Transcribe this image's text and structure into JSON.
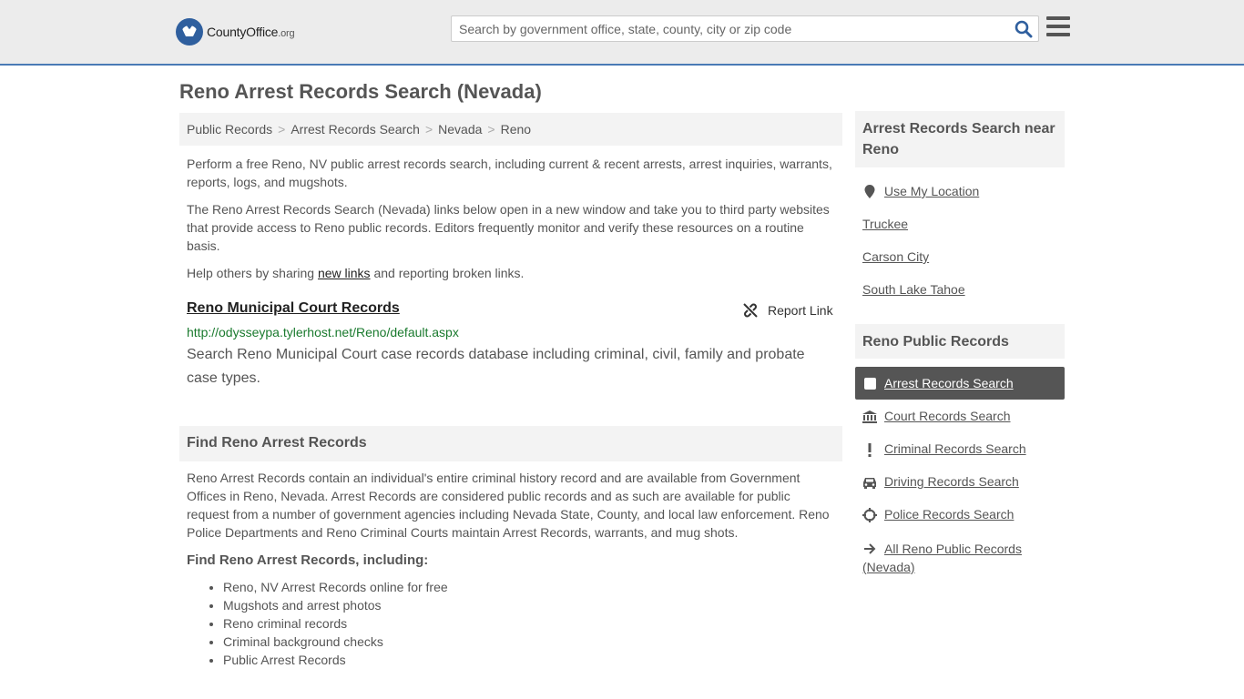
{
  "header": {
    "logo_name": "CountyOffice",
    "logo_tld": ".org",
    "search_placeholder": "Search by government office, state, county, city or zip code"
  },
  "page_title": "Reno Arrest Records Search (Nevada)",
  "breadcrumb": [
    "Public Records",
    "Arrest Records Search",
    "Nevada",
    "Reno"
  ],
  "intro": {
    "p1": "Perform a free Reno, NV public arrest records search, including current & recent arrests, arrest inquiries, warrants, reports, logs, and mugshots.",
    "p2": "The Reno Arrest Records Search (Nevada) links below open in a new window and take you to third party websites that provide access to Reno public records. Editors frequently monitor and verify these resources on a routine basis.",
    "p3_before": "Help others by sharing ",
    "p3_link": "new links",
    "p3_after": " and reporting broken links."
  },
  "result": {
    "title": "Reno Municipal Court Records",
    "report_label": "Report Link",
    "url": "http://odysseypa.tylerhost.net/Reno/default.aspx",
    "description": "Search Reno Municipal Court case records database including criminal, civil, family and probate case types."
  },
  "find_section": {
    "heading": "Find Reno Arrest Records",
    "text": "Reno Arrest Records contain an individual's entire criminal history record and are available from Government Offices in Reno, Nevada. Arrest Records are considered public records and as such are available for public request from a number of government agencies including Nevada State, County, and local law enforcement. Reno Police Departments and Reno Criminal Courts maintain Arrest Records, warrants, and mug shots.",
    "subheading": "Find Reno Arrest Records, including:",
    "items": [
      "Reno, NV Arrest Records online for free",
      "Mugshots and arrest photos",
      "Reno criminal records",
      "Criminal background checks",
      "Public Arrest Records"
    ]
  },
  "sidebar": {
    "nearby_heading": "Arrest Records Search near Reno",
    "use_location": "Use My Location",
    "nearby": [
      "Truckee",
      "Carson City",
      "South Lake Tahoe"
    ],
    "records_heading": "Reno Public Records",
    "active_item": "Arrest Records Search",
    "items": [
      {
        "label": "Court Records Search",
        "icon": "courthouse-icon"
      },
      {
        "label": "Criminal Records Search",
        "icon": "exclamation-icon"
      },
      {
        "label": "Driving Records Search",
        "icon": "car-icon"
      },
      {
        "label": "Police Records Search",
        "icon": "crosshair-icon"
      }
    ],
    "all_records": "All Reno Public Records (Nevada)"
  }
}
